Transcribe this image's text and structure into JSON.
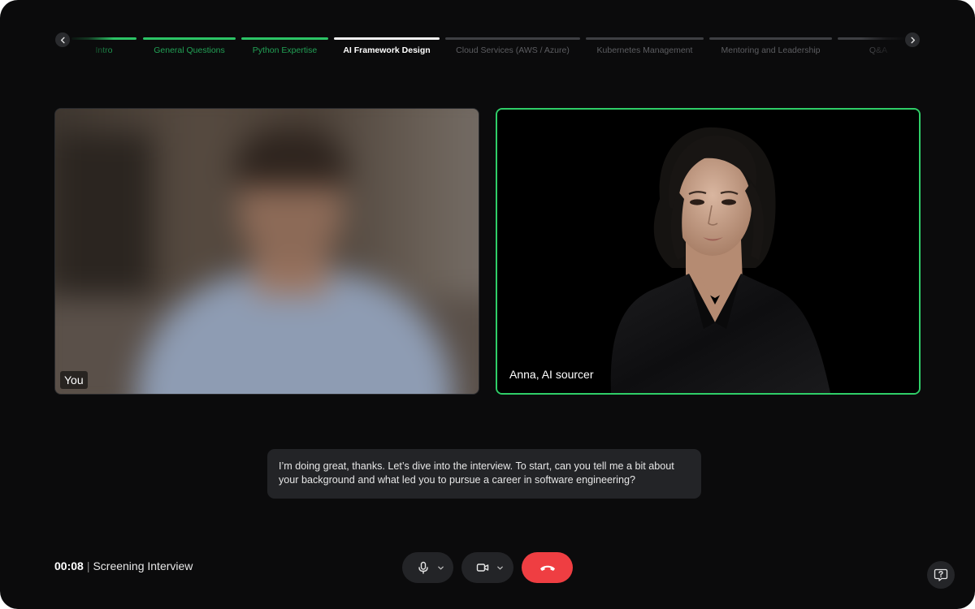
{
  "steps": [
    {
      "label": "Intro",
      "state": "done"
    },
    {
      "label": "General Questions",
      "state": "done"
    },
    {
      "label": "Python Expertise",
      "state": "done"
    },
    {
      "label": "AI Framework Design",
      "state": "active"
    },
    {
      "label": "Cloud Services (AWS / Azure)",
      "state": "upcoming"
    },
    {
      "label": "Kubernetes Management",
      "state": "upcoming"
    },
    {
      "label": "Mentoring and Leadership",
      "state": "upcoming"
    },
    {
      "label": "Q&A",
      "state": "upcoming"
    }
  ],
  "participants": {
    "you": {
      "name": "You"
    },
    "ai": {
      "name": "Anna, AI sourcer"
    }
  },
  "caption": {
    "text": "I’m doing great, thanks. Let’s dive into the interview. To start, can you tell me a bit about your background and what led you to pursue a career in software engineering?"
  },
  "session": {
    "timer": "00:08",
    "separator": "|",
    "title": "Screening Interview"
  },
  "controls": {
    "mic_icon": "microphone-icon",
    "camera_icon": "video-camera-icon",
    "end_icon": "phone-hangup-icon",
    "help_icon": "help-chat-icon"
  },
  "colors": {
    "background": "#0b0b0c",
    "accent_green": "#2fce68",
    "done_label": "#22a055",
    "end_call_red": "#ef3e42",
    "panel": "#232427"
  }
}
